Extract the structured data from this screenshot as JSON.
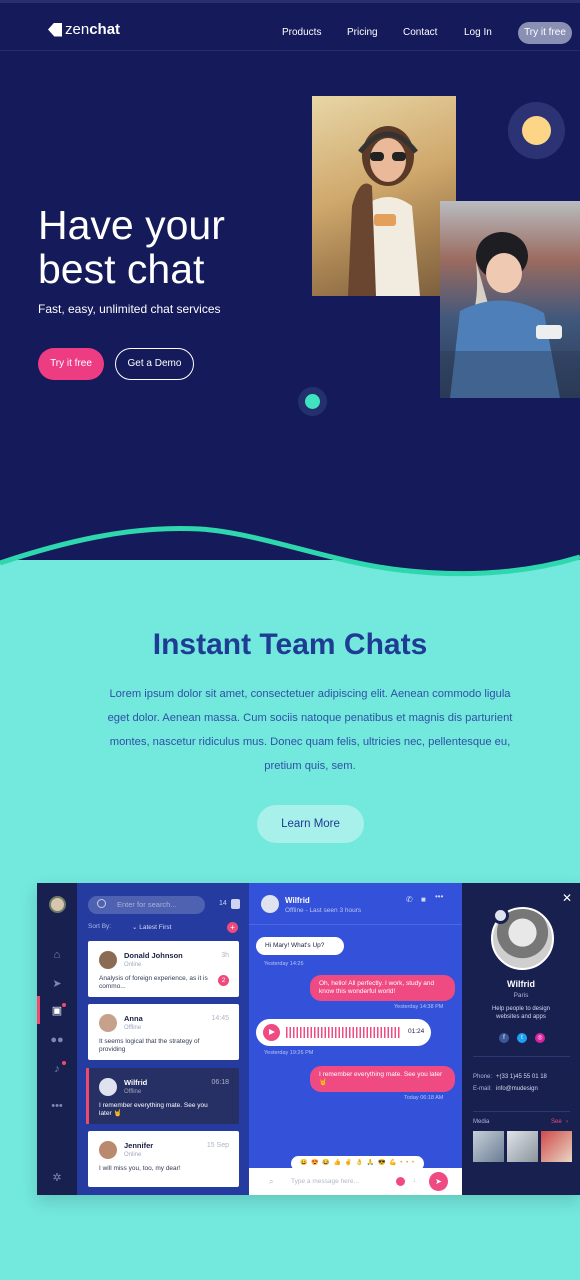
{
  "nav": {
    "logo_light": "zen",
    "logo_bold": "chat",
    "links": [
      "Products",
      "Pricing",
      "Contact",
      "Log In"
    ],
    "cta": "Try it free"
  },
  "hero": {
    "title_line1": "Have your",
    "title_line2": "best chat",
    "subtitle": "Fast, easy, unlimited chat services",
    "primary_button": "Try it free",
    "secondary_button": "Get a Demo"
  },
  "features": {
    "title": "Instant Team Chats",
    "text": "Lorem ipsum dolor sit amet, consectetuer adipiscing elit. Aenean commodo ligula eget dolor. Aenean massa. Cum sociis natoque penatibus et magnis dis parturient montes, nascetur ridiculus mus. Donec quam felis, ultricies nec, pellentesque eu, pretium quis, sem.",
    "button": "Learn More"
  },
  "app": {
    "search_placeholder": "Enter for search...",
    "count": "14",
    "sort_label": "Sort By:",
    "sort_value": "Latest First",
    "conversations": [
      {
        "name": "Donald Johnson",
        "status": "Online",
        "time": "3h",
        "text": "Analysis of foreign experience, as it is commo...",
        "badge": "2"
      },
      {
        "name": "Anna",
        "status": "Offline",
        "time": "14:45",
        "text": "It seems logical that the strategy of providing"
      },
      {
        "name": "Wilfrid",
        "status": "Offline",
        "time": "06:18",
        "text": "I remember everything mate. See you later 🤘"
      },
      {
        "name": "Jennifer",
        "status": "Online",
        "time": "15 Sep",
        "text": "I will miss you, too, my dear!"
      }
    ],
    "chat": {
      "name": "Wilfrid",
      "status": "Offline - Last seen 3 hours",
      "messages": [
        {
          "text": "Hi Mary! What's Up?",
          "meta": "Yesterday 14:26"
        },
        {
          "text": "Oh, hello! All perfectly. I work, study and know this wonderful world!",
          "meta": "Yesterday 14:38 PM"
        },
        {
          "voice_time": "01:24",
          "meta": "Yesterday 19:26 PM"
        },
        {
          "text": "I remember everything mate. See you later 🤘",
          "meta": "Today 06:18 AM"
        }
      ],
      "emojis": "😀 😍 😂 👍 ✌ 👌 🙏 😎 💪 • • •",
      "composer_placeholder": "Type a message here..."
    },
    "profile": {
      "name": "Wilfrid",
      "city": "Paris",
      "bio": "Help people to design websites and apps",
      "phone_label": "Phone:",
      "phone": "+(33 1)45 55 01 18",
      "email_label": "E-mail:",
      "email": "info@mudesign",
      "media_label": "Media",
      "media_link": "See"
    }
  },
  "colors": {
    "hero_bg": "#141a5a",
    "accent_pink": "#ee3c83",
    "teal": "#73e8dd",
    "heading_blue": "#1f3b93",
    "chat_blue": "#3352d9"
  }
}
